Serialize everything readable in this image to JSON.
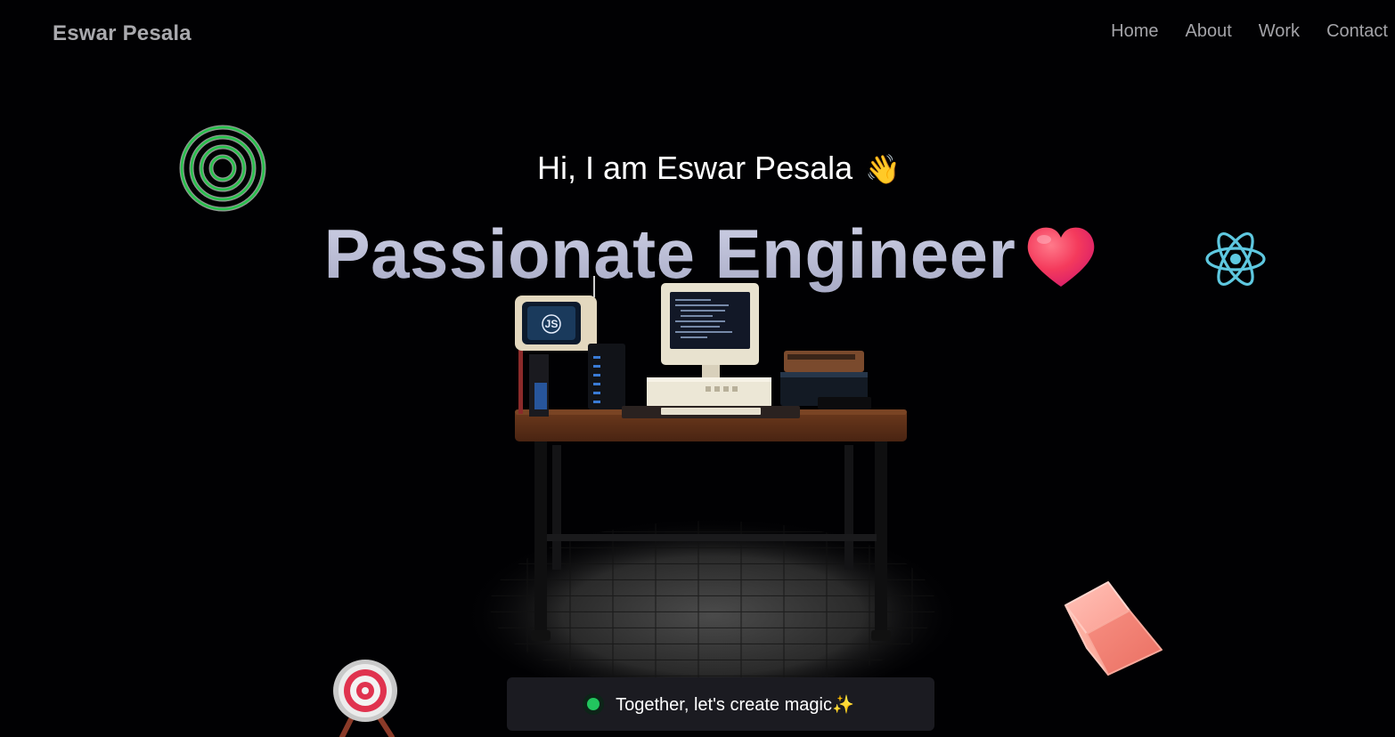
{
  "nav": {
    "brand": "Eswar Pesala",
    "links": [
      "Home",
      "About",
      "Work",
      "Contact"
    ]
  },
  "hero": {
    "greeting": "Hi, I am Eswar Pesala",
    "greeting_emoji": "👋",
    "headline": "Passionate Engineer",
    "cta_text": "Together, let's create magic✨"
  },
  "icons": {
    "rings": "concentric-rings-icon",
    "heart": "heart-icon",
    "react": "react-icon",
    "cube": "cube-icon",
    "target": "target-icon",
    "scene": "desk-setup-illustration"
  },
  "colors": {
    "background": "#010103",
    "cta_background": "#1b1b21",
    "status_dot": "#22c55e",
    "react_blue": "#61dafb",
    "ring_green": "#22c55e"
  }
}
